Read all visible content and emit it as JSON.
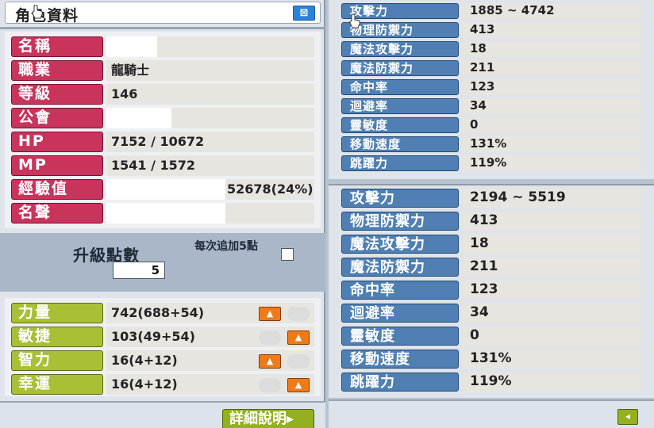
{
  "window": {
    "title": "角色資料",
    "close_glyph": "⊠"
  },
  "info": [
    {
      "label": "名稱",
      "value": ""
    },
    {
      "label": "職業",
      "value": "龍騎士"
    },
    {
      "label": "等級",
      "value": "146"
    },
    {
      "label": "公會",
      "value": ""
    },
    {
      "label": "HP",
      "value": "7152 / 10672"
    },
    {
      "label": "MP",
      "value": "1541 / 1572"
    },
    {
      "label": "經驗值",
      "value": "52678(24%)"
    },
    {
      "label": "名聲",
      "value": ""
    }
  ],
  "points": {
    "label": "升級點數",
    "value": "5",
    "auto_label": "每次追加5點",
    "auto_checked": false
  },
  "stats": [
    {
      "label": "力量",
      "value": "742(688+54)",
      "can_raise": true
    },
    {
      "label": "敏捷",
      "value": "103(49+54)",
      "can_raise": true
    },
    {
      "label": "智力",
      "value": "16(4+12)",
      "can_raise": true
    },
    {
      "label": "幸運",
      "value": "16(4+12)",
      "can_raise": true
    }
  ],
  "detail_button": "詳細說明▸",
  "panel_top": [
    {
      "label": "攻擊力",
      "value": "1885 ~ 4742"
    },
    {
      "label": "物理防禦力",
      "value": "413"
    },
    {
      "label": "魔法攻擊力",
      "value": "18"
    },
    {
      "label": "魔法防禦力",
      "value": "211"
    },
    {
      "label": "命中率",
      "value": "123"
    },
    {
      "label": "迴避率",
      "value": "34"
    },
    {
      "label": "靈敏度",
      "value": "0"
    },
    {
      "label": "移動速度",
      "value": "131%"
    },
    {
      "label": "跳躍力",
      "value": "119%"
    }
  ],
  "panel_bottom": [
    {
      "label": "攻擊力",
      "value": "2194 ~ 5519"
    },
    {
      "label": "物理防禦力",
      "value": "413"
    },
    {
      "label": "魔法攻擊力",
      "value": "18"
    },
    {
      "label": "魔法防禦力",
      "value": "211"
    },
    {
      "label": "命中率",
      "value": "123"
    },
    {
      "label": "迴避率",
      "value": "34"
    },
    {
      "label": "靈敏度",
      "value": "0"
    },
    {
      "label": "移動速度",
      "value": "131%"
    },
    {
      "label": "跳躍力",
      "value": "119%"
    }
  ],
  "back_glyph": "◂",
  "colors": {
    "red_label": "#c8345c",
    "green_label": "#a8bf36",
    "blue_label": "#4f7fb3",
    "raise_button": "#ee7a18"
  }
}
